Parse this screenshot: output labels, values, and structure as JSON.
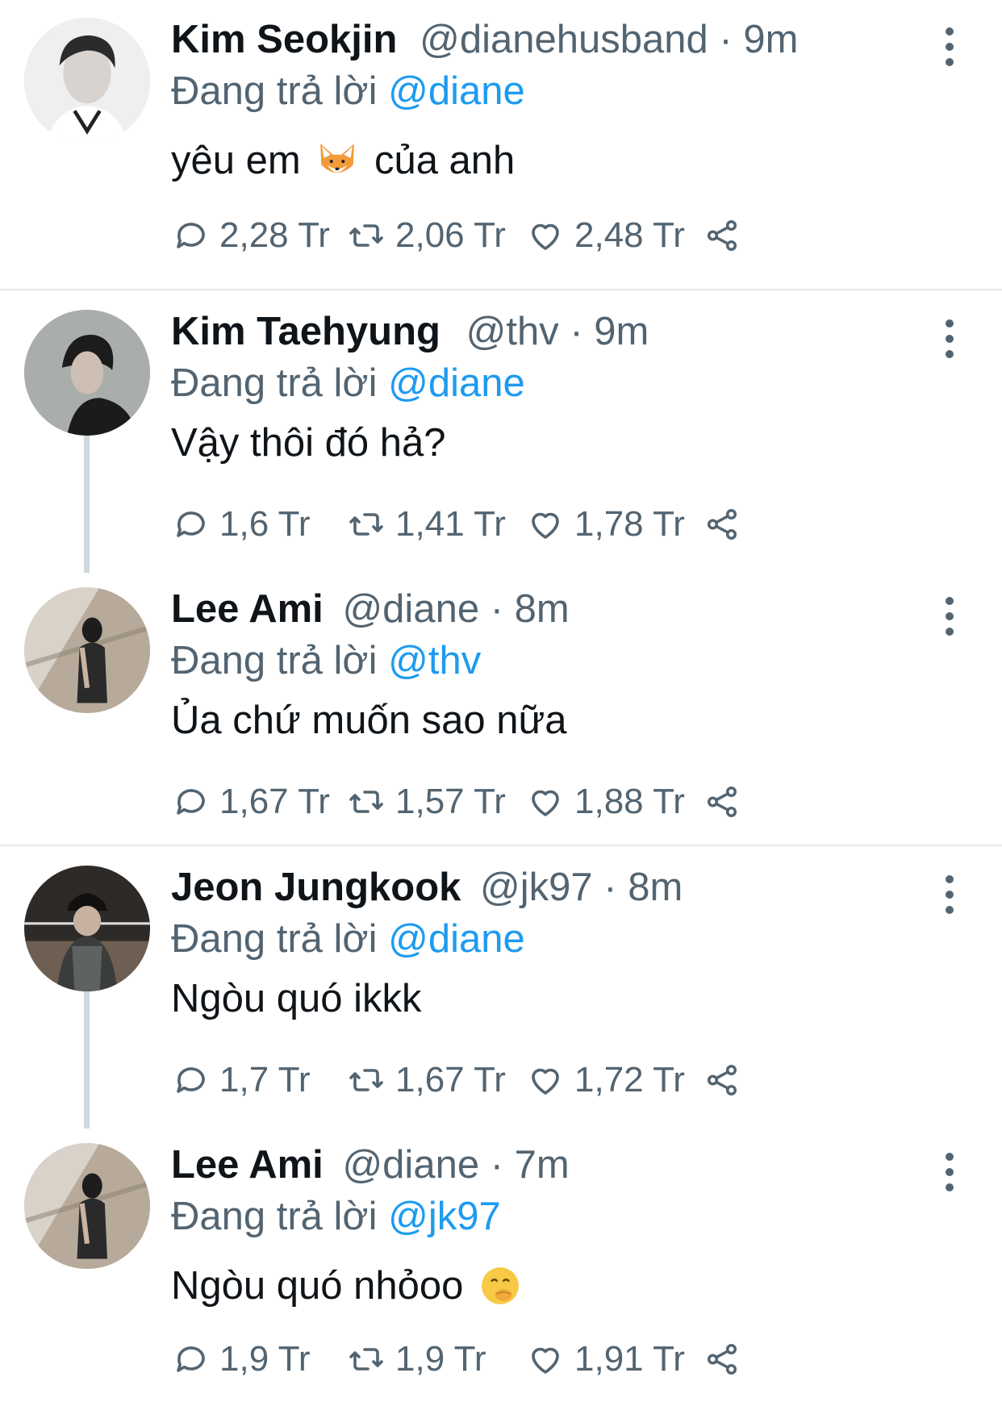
{
  "tweets": [
    {
      "name": "Kim Seokjin",
      "handle": "@dianehusband",
      "sep": "·",
      "time": "9m",
      "reply_prefix": "Đang trả lời",
      "reply_to": "@diane",
      "text_before": "yêu em",
      "emoji": "fox-emoji",
      "text_after": "của anh",
      "replies": "2,28 Tr",
      "retweets": "2,06 Tr",
      "likes": "2,48 Tr"
    },
    {
      "name": "Kim Taehyung",
      "handle": "@thv",
      "sep": "·",
      "time": "9m",
      "reply_prefix": "Đang trả lời",
      "reply_to": "@diane",
      "text": "Vậy thôi đó hả?",
      "replies": "1,6 Tr",
      "retweets": "1,41 Tr",
      "likes": "1,78 Tr"
    },
    {
      "name": "Lee Ami",
      "handle": "@diane",
      "sep": "·",
      "time": "8m",
      "reply_prefix": "Đang trả lời",
      "reply_to": "@thv",
      "text": "Ủa chứ muốn sao nữa",
      "replies": "1,67 Tr",
      "retweets": "1,57 Tr",
      "likes": "1,88 Tr"
    },
    {
      "name": "Jeon Jungkook",
      "handle": "@jk97",
      "sep": "·",
      "time": "8m",
      "reply_prefix": "Đang trả lời",
      "reply_to": "@diane",
      "text": "Ngòu quó ikkk",
      "replies": "1,7 Tr",
      "retweets": "1,67 Tr",
      "likes": "1,72 Tr"
    },
    {
      "name": "Lee Ami",
      "handle": "@diane",
      "sep": "·",
      "time": "7m",
      "reply_prefix": "Đang trả lời",
      "reply_to": "@jk97",
      "text_before": "Ngòu quó nhỏoo",
      "emoji": "hand-over-mouth-emoji",
      "replies": "1,9 Tr",
      "retweets": "1,9 Tr",
      "likes": "1,91 Tr"
    }
  ],
  "colors": {
    "accent": "#1d9bf0",
    "muted": "#536471",
    "text": "#0f1419",
    "thread": "#cfd9de"
  }
}
